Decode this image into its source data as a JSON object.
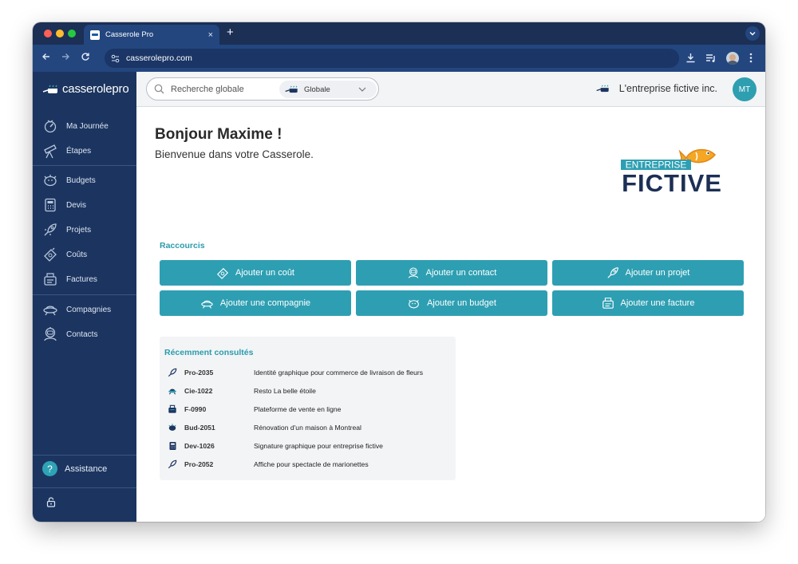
{
  "browser": {
    "tab_title": "Casserole Pro",
    "tab_close": "×",
    "new_tab": "+",
    "url": "casserolepro.com"
  },
  "app": {
    "logo_text": "casserolepro",
    "colors": {
      "sidebar": "#1c3560",
      "accent": "#2e9fb2",
      "chrome": "#23467f"
    }
  },
  "sidebar": {
    "items": [
      {
        "label": "Ma Journée",
        "icon": "gauge-icon"
      },
      {
        "label": "Étapes",
        "icon": "telescope-icon"
      },
      {
        "label": "Budgets",
        "icon": "piggy-bank-icon"
      },
      {
        "label": "Devis",
        "icon": "calculator-icon"
      },
      {
        "label": "Projets",
        "icon": "rocket-icon"
      },
      {
        "label": "Coûts",
        "icon": "money-icon"
      },
      {
        "label": "Factures",
        "icon": "invoice-icon"
      },
      {
        "label": "Compagnies",
        "icon": "ufo-icon"
      },
      {
        "label": "Contacts",
        "icon": "astronaut-icon"
      }
    ],
    "assistance": "Assistance",
    "assistance_icon": "?"
  },
  "header": {
    "search_placeholder": "Recherche globale",
    "scope_label": "Globale",
    "company_name": "L'entreprise fictive inc.",
    "avatar_initials": "MT"
  },
  "main": {
    "greeting": "Bonjour Maxime !",
    "welcome": "Bienvenue dans votre Casserole.",
    "brand_logo": {
      "line1": "ENTREPRISE",
      "line2": "FICTIVE"
    },
    "shortcuts_title": "Raccourcis",
    "shortcuts": [
      {
        "label": "Ajouter un coût",
        "icon": "money-icon"
      },
      {
        "label": "Ajouter un contact",
        "icon": "astronaut-icon"
      },
      {
        "label": "Ajouter un projet",
        "icon": "rocket-icon"
      },
      {
        "label": "Ajouter une compagnie",
        "icon": "ufo-icon"
      },
      {
        "label": "Ajouter un budget",
        "icon": "piggy-bank-icon"
      },
      {
        "label": "Ajouter une facture",
        "icon": "invoice-icon"
      }
    ],
    "recent_title": "Récemment consultés",
    "recent": [
      {
        "code": "Pro-2035",
        "desc": "Identité graphique pour commerce de livraison de fleurs",
        "icon": "rocket-icon"
      },
      {
        "code": "Cie-1022",
        "desc": "Resto La belle étoile",
        "icon": "ufo-icon"
      },
      {
        "code": "F-0990",
        "desc": "Plateforme de vente en ligne",
        "icon": "invoice-icon"
      },
      {
        "code": "Bud-2051",
        "desc": "Rénovation d'un maison à Montreal",
        "icon": "piggy-bank-icon"
      },
      {
        "code": "Dev-1026",
        "desc": "Signature graphique pour entreprise fictive",
        "icon": "calculator-icon"
      },
      {
        "code": "Pro-2052",
        "desc": "Affiche pour spectacle de marionettes",
        "icon": "rocket-icon"
      }
    ]
  }
}
